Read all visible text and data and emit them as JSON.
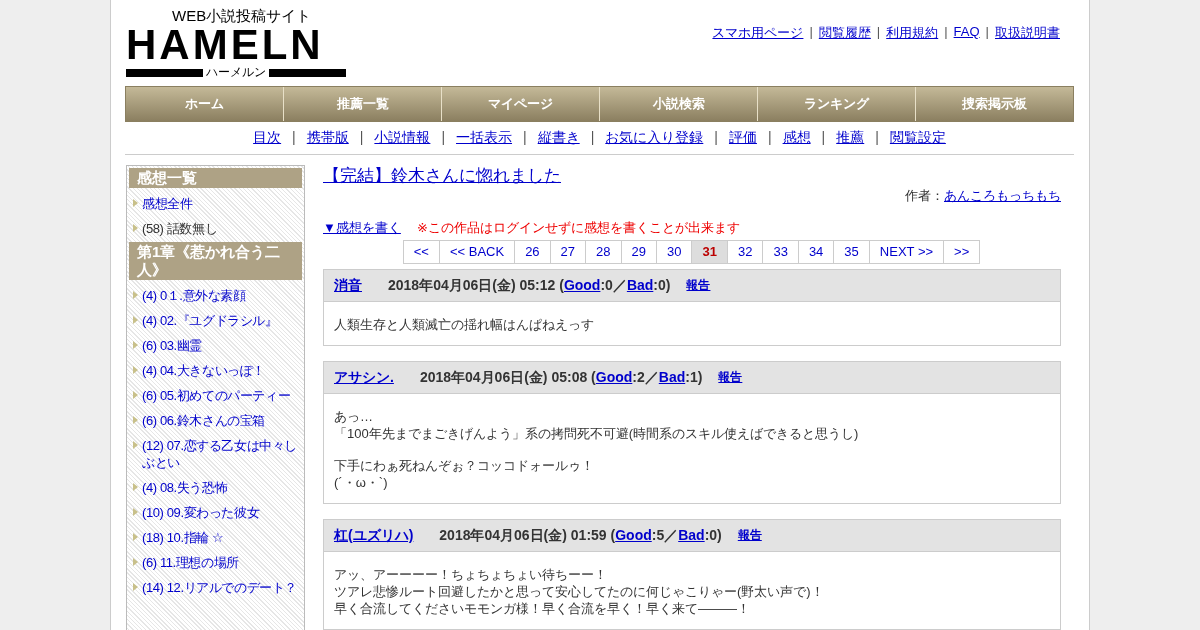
{
  "logo": {
    "tagline": "WEB小説投稿サイト",
    "name": "HAMELN",
    "reading": "ハーメルン"
  },
  "separator": "|",
  "top_links": [
    "スマホ用ページ",
    "閲覧履歴",
    "利用規約",
    "FAQ",
    "取扱説明書"
  ],
  "nav": [
    "ホーム",
    "推薦一覧",
    "マイページ",
    "小説検索",
    "ランキング",
    "捜索掲示板"
  ],
  "sub_nav": [
    "目次",
    "携帯版",
    "小説情報",
    "一括表示",
    "縦書き",
    "お気に入り登録",
    "評価",
    "感想",
    "推薦",
    "閲覧設定"
  ],
  "sidebar": [
    {
      "kind": "heading",
      "text": "感想一覧"
    },
    {
      "kind": "link",
      "text": "感想全件"
    },
    {
      "kind": "text",
      "text": "(58) 話数無し"
    },
    {
      "kind": "heading",
      "text": "第1章《惹かれ合う二人》"
    },
    {
      "kind": "link",
      "text": "(4) 0１.意外な素顔"
    },
    {
      "kind": "link",
      "text": "(4) 02.『ユグドラシル』"
    },
    {
      "kind": "link",
      "text": "(6) 03.幽霊"
    },
    {
      "kind": "link",
      "text": "(4) 04.大きないっぽ！"
    },
    {
      "kind": "link",
      "text": "(6) 05.初めてのパーティー"
    },
    {
      "kind": "link",
      "text": "(6) 06.鈴木さんの宝箱"
    },
    {
      "kind": "link",
      "text": "(12) 07.恋する乙女は中々しぶとい"
    },
    {
      "kind": "link",
      "text": "(4) 08.失う恐怖"
    },
    {
      "kind": "link",
      "text": "(10) 09.変わった彼女"
    },
    {
      "kind": "link",
      "text": "(18) 10.指輪 ☆"
    },
    {
      "kind": "link",
      "text": "(6) 11.理想の場所"
    },
    {
      "kind": "link",
      "text": "(14) 12.リアルでのデート？"
    }
  ],
  "novel_title": "【完結】鈴木さんに惚れました",
  "author_label": "作者：",
  "author": "あんころもっちもち",
  "write_link": "▼感想を書く",
  "notice": "※この作品はログインせずに感想を書くことが出来ます",
  "pager": [
    {
      "label": "<<",
      "selected": false
    },
    {
      "label": "<< BACK",
      "selected": false
    },
    {
      "label": "26",
      "selected": false
    },
    {
      "label": "27",
      "selected": false
    },
    {
      "label": "28",
      "selected": false
    },
    {
      "label": "29",
      "selected": false
    },
    {
      "label": "30",
      "selected": false
    },
    {
      "label": "31",
      "selected": true
    },
    {
      "label": "32",
      "selected": false
    },
    {
      "label": "33",
      "selected": false
    },
    {
      "label": "34",
      "selected": false
    },
    {
      "label": "35",
      "selected": false
    },
    {
      "label": "NEXT >>",
      "selected": false
    },
    {
      "label": ">>",
      "selected": false
    }
  ],
  "comments": [
    {
      "author": "消音",
      "meta": [
        {
          "kind": "text",
          "text": "2018年04月06日(金) 05:12 ("
        },
        {
          "kind": "link",
          "text": "Good"
        },
        {
          "kind": "text",
          "text": ":0／"
        },
        {
          "kind": "link",
          "text": "Bad"
        },
        {
          "kind": "text",
          "text": ":0)"
        }
      ],
      "report": "報告",
      "paragraphs": [
        [
          "人類生存と人類滅亡の揺れ幅はんぱねえっす"
        ]
      ]
    },
    {
      "author": "アサシン.",
      "meta": [
        {
          "kind": "text",
          "text": "2018年04月06日(金) 05:08 ("
        },
        {
          "kind": "link",
          "text": "Good"
        },
        {
          "kind": "text",
          "text": ":2／"
        },
        {
          "kind": "link",
          "text": "Bad"
        },
        {
          "kind": "text",
          "text": ":1)"
        }
      ],
      "report": "報告",
      "paragraphs": [
        [
          "あっ…",
          "「100年先までまごきげんよう」系の拷問死不可避(時間系のスキル使えばできると思うし)"
        ],
        [
          "下手にわぁ死ねんぞぉ？コッコドォールゥ！",
          "(´・ω・`)"
        ]
      ]
    },
    {
      "author": "杠(ユズリハ)",
      "meta": [
        {
          "kind": "text",
          "text": "2018年04月06日(金) 01:59 ("
        },
        {
          "kind": "link",
          "text": "Good"
        },
        {
          "kind": "text",
          "text": ":5／"
        },
        {
          "kind": "link",
          "text": "Bad"
        },
        {
          "kind": "text",
          "text": ":0)"
        }
      ],
      "report": "報告",
      "paragraphs": [
        [
          "アッ、アーーーー！ちょちょちょい待ちーー！",
          "ツアレ悲惨ルート回避したかと思って安心してたのに何じゃこりゃー(野太い声で)！",
          "早く合流してくださいモモンガ様！早く合流を早く！早く来て———！"
        ]
      ]
    }
  ]
}
